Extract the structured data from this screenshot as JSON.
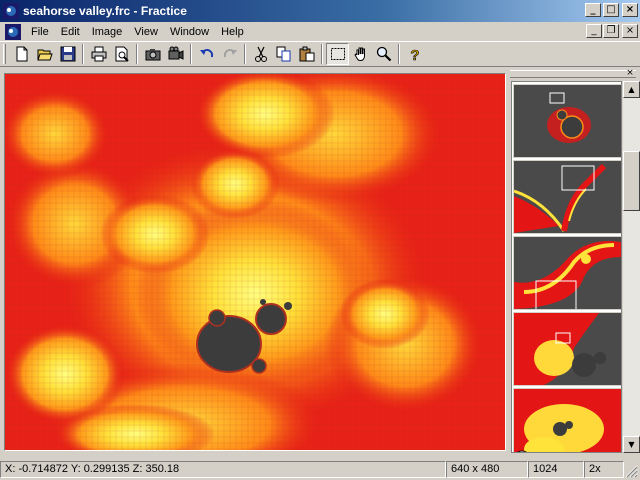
{
  "window": {
    "title": "seahorse valley.frc - Fractice"
  },
  "menu": {
    "items": [
      "File",
      "Edit",
      "Image",
      "View",
      "Window",
      "Help"
    ]
  },
  "toolbar": {
    "buttons": [
      "new-icon",
      "open-icon",
      "save-icon",
      "print-icon",
      "print-preview-icon",
      "snapshot-icon",
      "record-icon",
      "undo-icon",
      "redo-icon",
      "cut-icon",
      "copy-icon",
      "paste-icon",
      "select-icon",
      "hand-icon",
      "zoom-icon",
      "help-icon"
    ]
  },
  "status": {
    "coords": "X: -0.714872  Y: 0.299135  Z: 350.18",
    "size": "640 x 480",
    "iterations": "1024",
    "zoom": "2x"
  },
  "colors": {
    "title_start": "#0a246a",
    "title_end": "#a6caf0",
    "fractal_bg": "#e31515",
    "fractal_core": "#3c3c3c",
    "fractal_glow": "#ffe23a"
  }
}
